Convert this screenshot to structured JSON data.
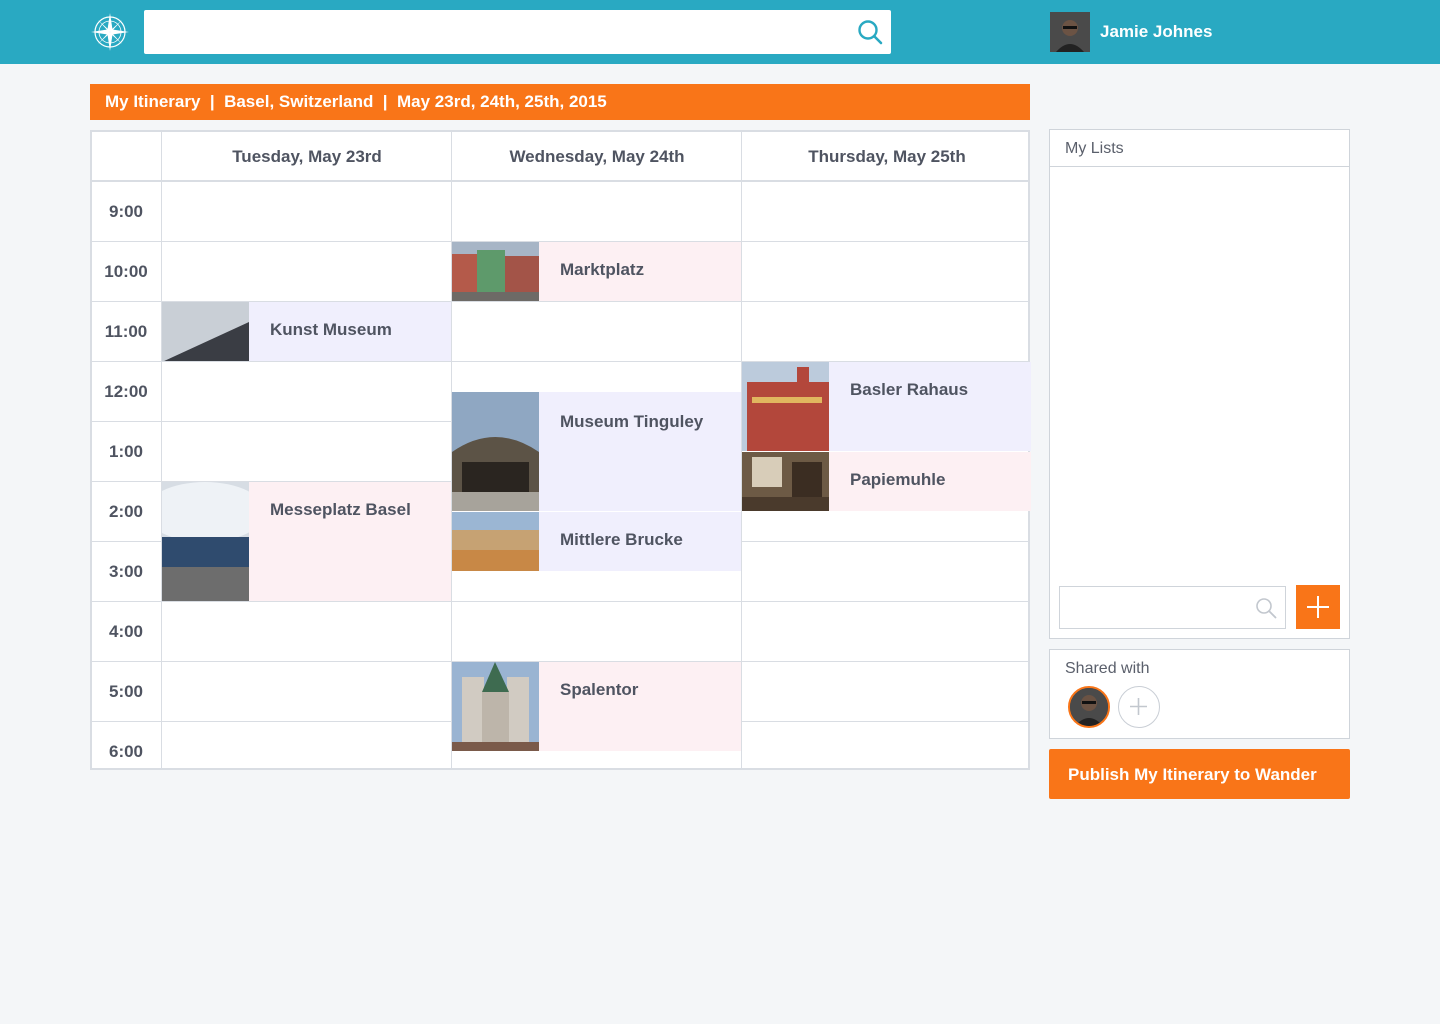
{
  "header": {
    "search_value": "",
    "username": "Jamie Johnes",
    "logo_icon": "compass-icon",
    "search_icon": "search-icon"
  },
  "title_bar": {
    "text": "My Itinerary  |  Basel, Switzerland  |  May 23rd, 24th, 25th, 2015"
  },
  "calendar": {
    "days": [
      "Tuesday, May 23rd",
      "Wednesday, May 24th",
      "Thursday, May 25th"
    ],
    "times": [
      "9:00",
      "10:00",
      "11:00",
      "12:00",
      "1:00",
      "2:00",
      "3:00",
      "4:00",
      "5:00",
      "6:00"
    ],
    "events": [
      {
        "name": "Kunst Museum",
        "day": 0,
        "start": 11,
        "end": 12,
        "color": "purple"
      },
      {
        "name": "Messeplatz Basel",
        "day": 0,
        "start": 14,
        "end": 16,
        "color": "pink"
      },
      {
        "name": "Marktplatz",
        "day": 1,
        "start": 10,
        "end": 11,
        "color": "pink"
      },
      {
        "name": "Museum Tinguley",
        "day": 1,
        "start": 12.5,
        "end": 14.5,
        "color": "purple"
      },
      {
        "name": "Mittlere Brucke",
        "day": 1,
        "start": 14.5,
        "end": 15.5,
        "color": "purple"
      },
      {
        "name": "Spalentor",
        "day": 1,
        "start": 17,
        "end": 18.5,
        "color": "pink"
      },
      {
        "name": "Basler Rahaus",
        "day": 2,
        "start": 12,
        "end": 13.5,
        "color": "purple"
      },
      {
        "name": "Papiemuhle",
        "day": 2,
        "start": 13.5,
        "end": 14.5,
        "color": "pink"
      }
    ]
  },
  "sidebar": {
    "lists_title": "My Lists",
    "list_search_value": "",
    "add_icon": "plus-icon",
    "shared_title": "Shared with",
    "add_person_icon": "plus-icon",
    "publish_label": "Publish My Itinerary to Wander"
  },
  "colors": {
    "header": "#29a9c2",
    "accent": "#f97518",
    "event_purple": "#f0effd",
    "event_pink": "#fdf0f3"
  }
}
